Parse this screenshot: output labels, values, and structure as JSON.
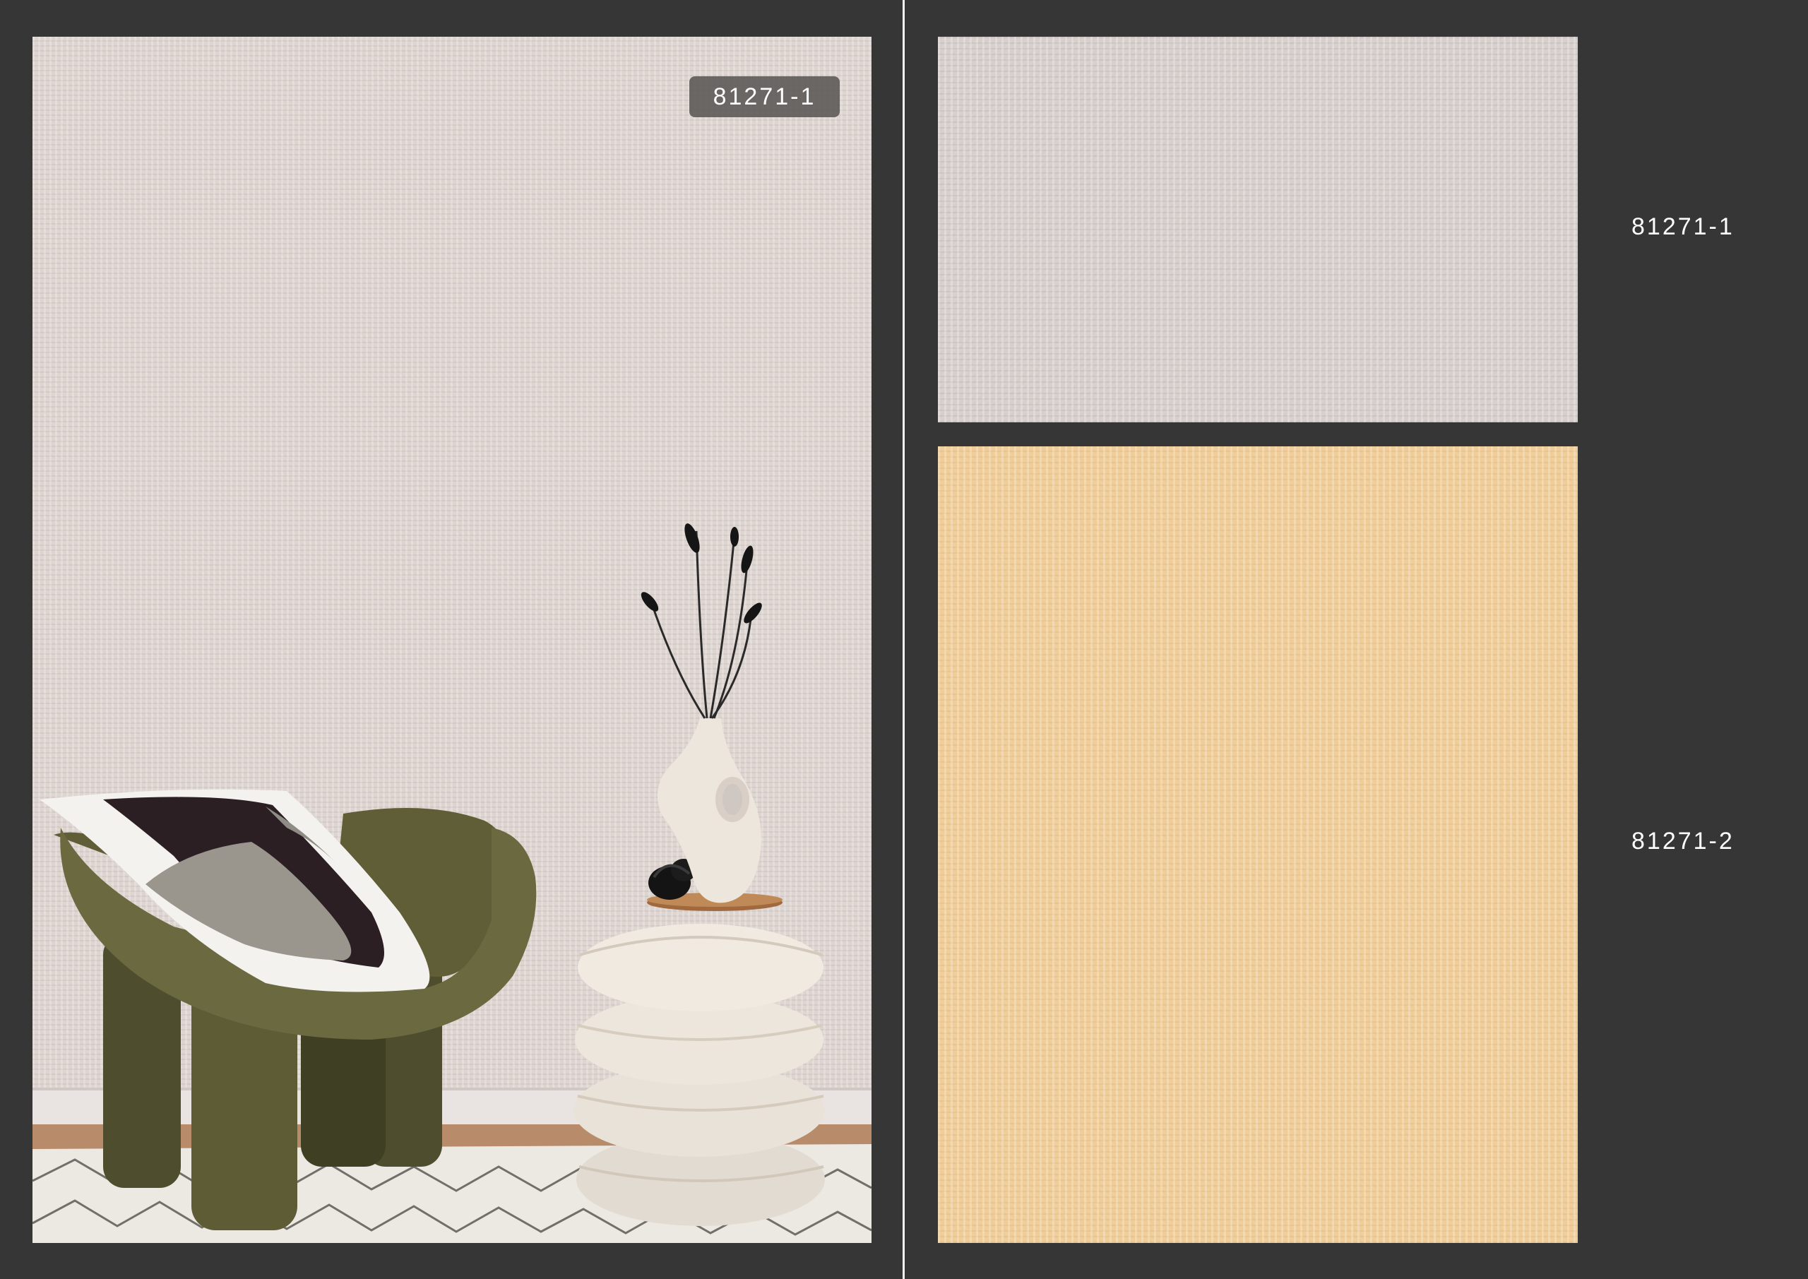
{
  "room_scene": {
    "badge_code": "81271-1"
  },
  "swatches": [
    {
      "code": "81271-1",
      "color": "#d6cfcc"
    },
    {
      "code": "81271-2",
      "color": "#efcc98"
    }
  ],
  "colors": {
    "background": "#363636",
    "divider": "#f2f2f2",
    "chair": "#5b5a34"
  }
}
